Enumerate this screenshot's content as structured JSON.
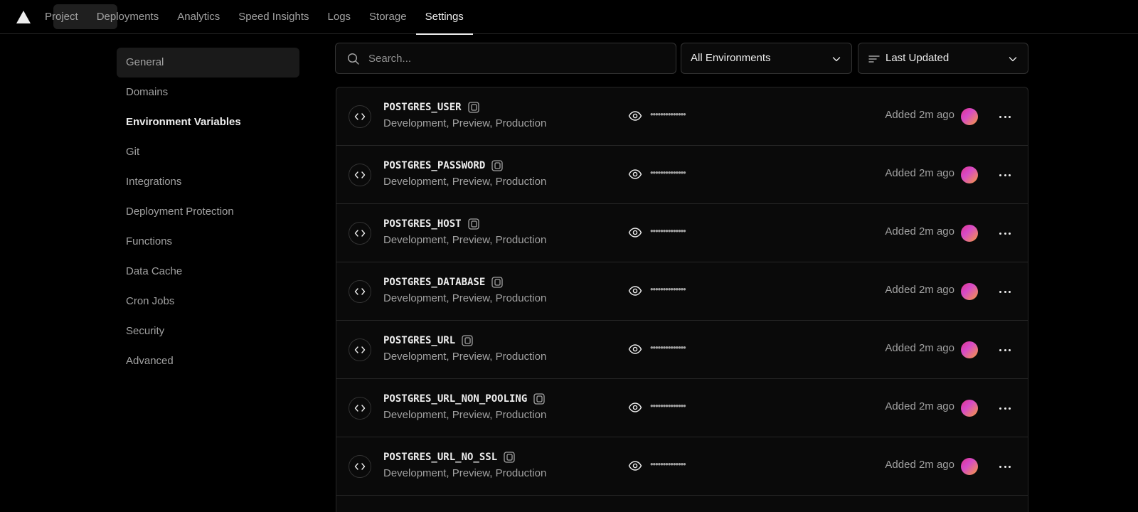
{
  "nav": {
    "tabs": [
      "Project",
      "Deployments",
      "Analytics",
      "Speed Insights",
      "Logs",
      "Storage",
      "Settings"
    ],
    "active_tab": "Settings"
  },
  "sidebar": {
    "items": [
      "General",
      "Domains",
      "Environment Variables",
      "Git",
      "Integrations",
      "Deployment Protection",
      "Functions",
      "Data Cache",
      "Cron Jobs",
      "Security",
      "Advanced"
    ]
  },
  "toolbar": {
    "search_placeholder": "Search...",
    "environment_filter": "All Environments",
    "sort": "Last Updated"
  },
  "variables": [
    {
      "name": "POSTGRES_USER",
      "environments": "Development, Preview, Production",
      "value_masked": "••••••••••••••",
      "added": "Added 2m ago"
    },
    {
      "name": "POSTGRES_PASSWORD",
      "environments": "Development, Preview, Production",
      "value_masked": "••••••••••••••",
      "added": "Added 2m ago"
    },
    {
      "name": "POSTGRES_HOST",
      "environments": "Development, Preview, Production",
      "value_masked": "••••••••••••••",
      "added": "Added 2m ago"
    },
    {
      "name": "POSTGRES_DATABASE",
      "environments": "Development, Preview, Production",
      "value_masked": "••••••••••••••",
      "added": "Added 2m ago"
    },
    {
      "name": "POSTGRES_URL",
      "environments": "Development, Preview, Production",
      "value_masked": "••••••••••••••",
      "added": "Added 2m ago"
    },
    {
      "name": "POSTGRES_URL_NON_POOLING",
      "environments": "Development, Preview, Production",
      "value_masked": "••••••••••••••",
      "added": "Added 2m ago"
    },
    {
      "name": "POSTGRES_URL_NO_SSL",
      "environments": "Development, Preview, Production",
      "value_masked": "••••••••••••••",
      "added": "Added 2m ago"
    }
  ],
  "colors": {
    "background": "#000000",
    "panel": "#0a0a0a",
    "border": "#262626",
    "text": "#ededed",
    "muted": "#a1a1a1",
    "avatar_gradient": [
      "#e0348a",
      "#d64bc8",
      "#f59a3c"
    ]
  },
  "icons": [
    "vercel-logo-icon",
    "search-icon",
    "chevron-down-icon",
    "sort-lines-icon",
    "code-brackets-icon",
    "copy-icon",
    "eye-icon",
    "more-horizontal-icon"
  ]
}
